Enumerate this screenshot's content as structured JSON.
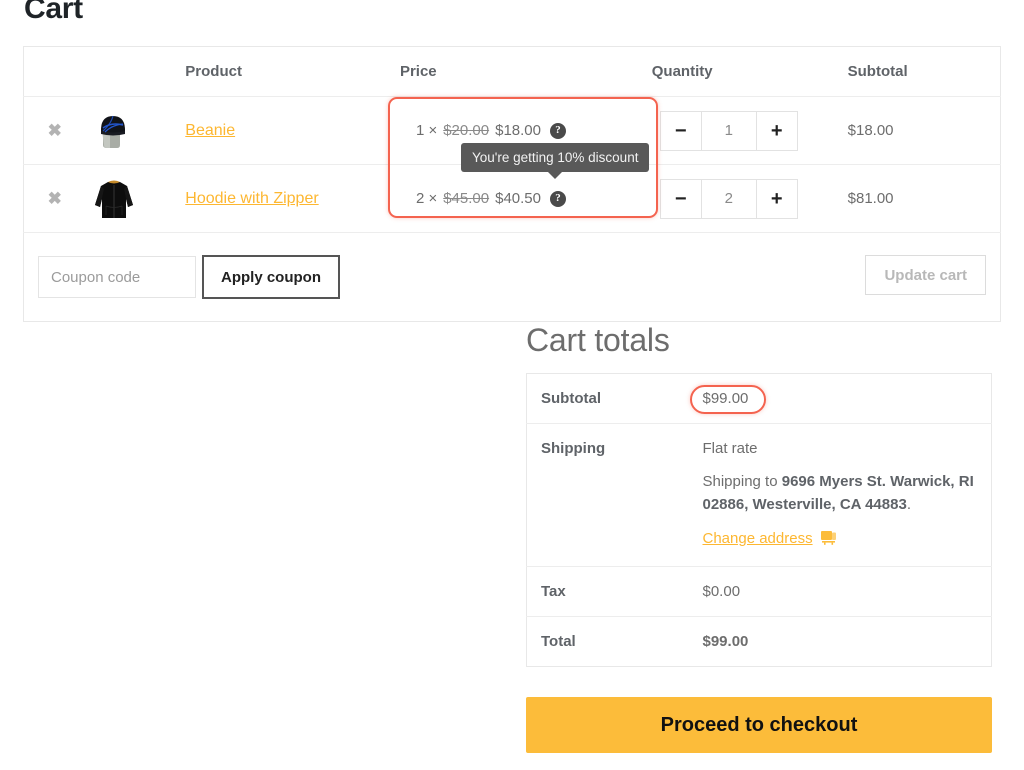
{
  "page": {
    "title": "Cart"
  },
  "cart_table": {
    "headers": {
      "remove": "",
      "thumbnail": "",
      "product": "Product",
      "price": "Price",
      "quantity": "Quantity",
      "subtotal": "Subtotal"
    },
    "remove_icon": "remove-x-icon",
    "rows": [
      {
        "remove_label": "✖",
        "thumb_alt": "beanie-thumbnail",
        "product": "Beanie",
        "price_qty": "1 ×",
        "price_old": "$20.00",
        "price_new": "$18.00",
        "help_glyph": "?",
        "qty_minus": "−",
        "qty_value": "1",
        "qty_plus": "+",
        "subtotal": "$18.00"
      },
      {
        "remove_label": "✖",
        "thumb_alt": "hoodie-thumbnail",
        "product": "Hoodie with Zipper",
        "price_qty": "2 ×",
        "price_old": "$45.00",
        "price_new": "$40.50",
        "help_glyph": "?",
        "qty_minus": "−",
        "qty_value": "2",
        "qty_plus": "+",
        "subtotal": "$81.00"
      }
    ],
    "coupon": {
      "placeholder": "Coupon code",
      "value": "",
      "apply_label": "Apply coupon"
    },
    "update_cart_label": "Update cart"
  },
  "tooltip": {
    "text": "You're getting 10% discount"
  },
  "totals": {
    "title": "Cart totals",
    "subtotal_label": "Subtotal",
    "subtotal_value": "$99.00",
    "shipping_label": "Shipping",
    "shipping_method": "Flat rate",
    "shipping_to_prefix": "Shipping to ",
    "shipping_address": "9696 Myers St. Warwick, RI 02886, Westerville, CA 44883",
    "shipping_to_suffix": ".",
    "change_address_label": "Change address",
    "change_address_icon": "address-card-icon",
    "tax_label": "Tax",
    "tax_value": "$0.00",
    "total_label": "Total",
    "total_value": "$99.00",
    "checkout_label": "Proceed to checkout"
  },
  "annotations": {
    "price_column_highlight": "price-cells-highlight",
    "subtotal_highlight": "subtotal-value-highlight",
    "highlight_color": "#f4634f"
  },
  "colors": {
    "accent": "#fdb731",
    "checkout_button": "#fcbc3a",
    "text": "#6d6d6d",
    "heading": "#1e2327",
    "border": "#e8e8e8",
    "tooltip_bg": "#595959"
  }
}
